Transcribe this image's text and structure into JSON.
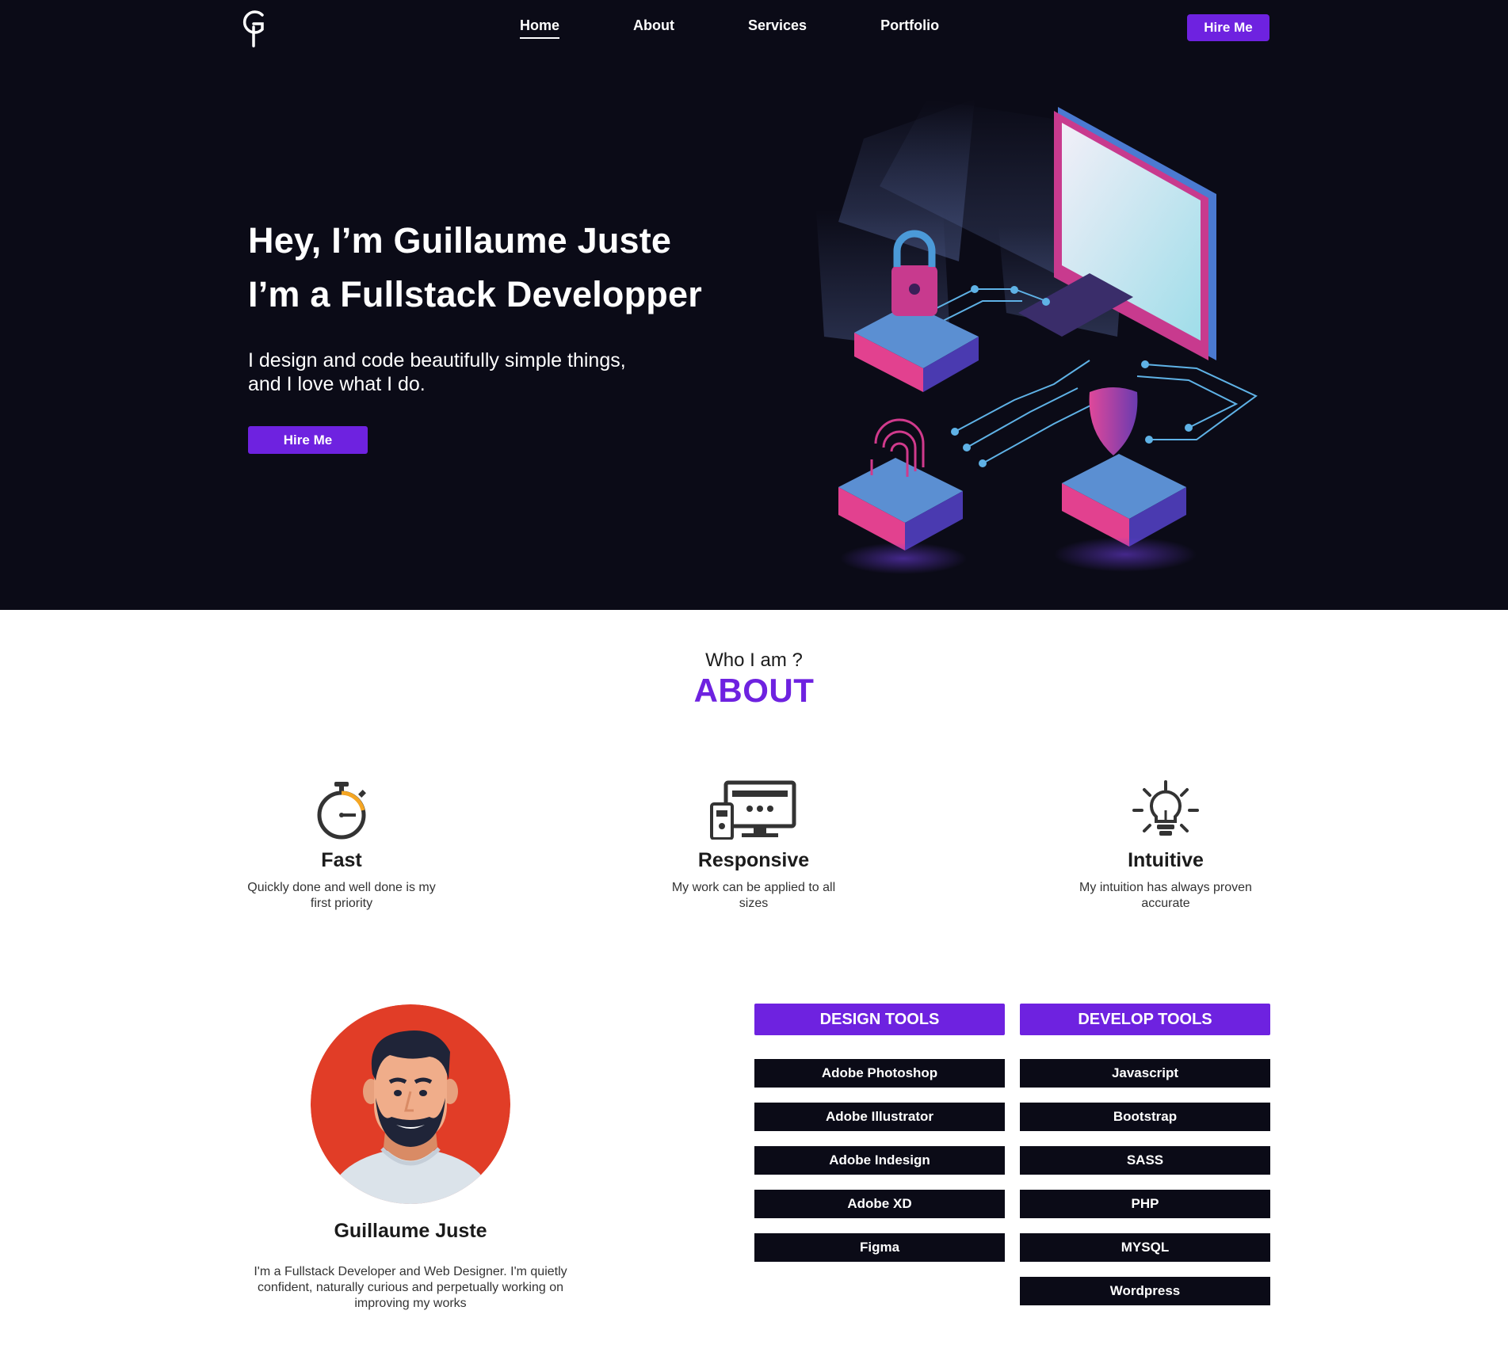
{
  "nav": {
    "logo_icon": "g-logo-icon",
    "links": [
      "Home",
      "About",
      "Services",
      "Portfolio"
    ],
    "active_link": "Home",
    "hire_label": "Hire Me"
  },
  "hero": {
    "title_line1": "Hey, I’m Guillaume Juste",
    "title_line2": "I’m a Fullstack Developper",
    "subtitle_line1": "I design and code beautifully simple things,",
    "subtitle_line2": "and I love what I do.",
    "hire_label": "Hire Me",
    "illustration": "isometric-security-computer-illustration"
  },
  "about": {
    "kicker": "Who I am ?",
    "title": "ABOUT",
    "features": [
      {
        "icon": "stopwatch-icon",
        "title": "Fast",
        "desc": "Quickly done and well done is my first priority"
      },
      {
        "icon": "devices-icon",
        "title": "Responsive",
        "desc": "My work can be applied to all sizes"
      },
      {
        "icon": "lightbulb-icon",
        "title": "Intuitive",
        "desc": "My intuition has always proven accurate"
      }
    ]
  },
  "profile": {
    "avatar_icon": "bearded-man-avatar",
    "name": "Guillaume Juste",
    "bio": "I'm a Fullstack Developer and Web Designer. I'm quietly confident, naturally curious and perpetually working on improving my works"
  },
  "tools": {
    "design": {
      "title": "DESIGN TOOLS",
      "items": [
        "Adobe Photoshop",
        "Adobe Illustrator",
        "Adobe Indesign",
        "Adobe XD",
        "Figma"
      ]
    },
    "develop": {
      "title": "DEVELOP TOOLS",
      "items": [
        "Javascript",
        "Bootstrap",
        "SASS",
        "PHP",
        "MYSQL",
        "Wordpress"
      ]
    }
  },
  "colors": {
    "accent": "#6e22e0",
    "dark": "#0b0b17",
    "avatar_bg": "#e13d27"
  }
}
